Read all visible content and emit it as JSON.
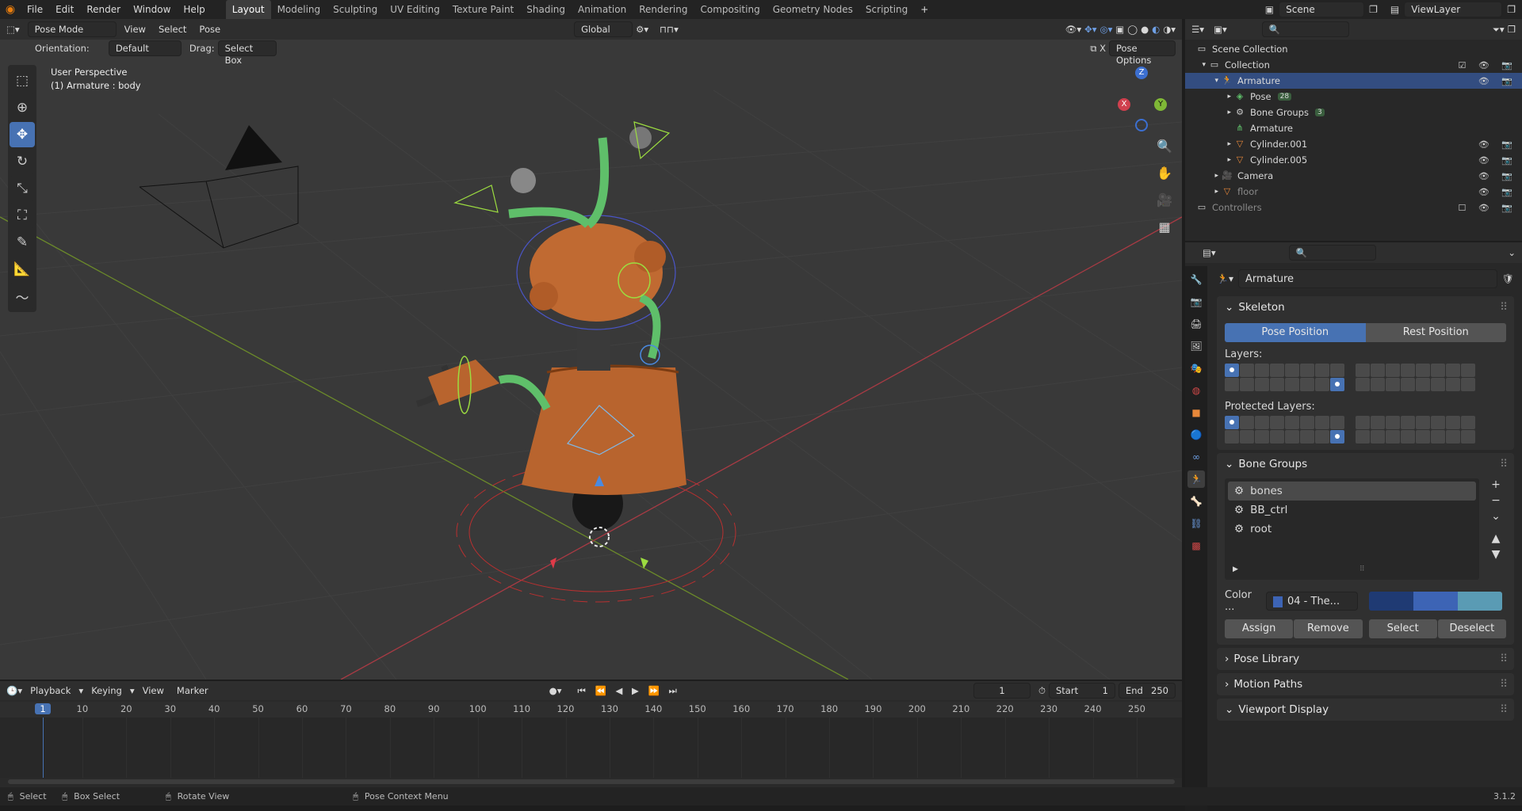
{
  "menu": {
    "file": "File",
    "edit": "Edit",
    "render": "Render",
    "window": "Window",
    "help": "Help"
  },
  "workspaces": [
    "Layout",
    "Modeling",
    "Sculpting",
    "UV Editing",
    "Texture Paint",
    "Shading",
    "Animation",
    "Rendering",
    "Compositing",
    "Geometry Nodes",
    "Scripting"
  ],
  "scene_name": "Scene",
  "view_layer": "ViewLayer",
  "viewport": {
    "mode": "Pose Mode",
    "menus": [
      "View",
      "Select",
      "Pose"
    ],
    "transform_orientation": "Global",
    "orientation_label": "Orientation:",
    "orientation_value": "Default",
    "drag_label": "Drag:",
    "drag_value": "Select Box",
    "pose_options": "Pose Options",
    "perspective": "User Perspective",
    "active": "(1) Armature : body",
    "axes": {
      "x": "X",
      "y": "Y",
      "z": "Z"
    }
  },
  "outliner": {
    "items": [
      {
        "label": "Scene Collection",
        "icon": "collection-icon"
      },
      {
        "label": "Collection",
        "icon": "collection-icon"
      },
      {
        "label": "Armature",
        "icon": "armature-icon"
      },
      {
        "label": "Pose",
        "icon": "pose-icon",
        "badge": "28"
      },
      {
        "label": "Bone Groups",
        "icon": "bone-groups-icon",
        "badge": "3"
      },
      {
        "label": "Armature",
        "icon": "armature-data-icon"
      },
      {
        "label": "Cylinder.001",
        "icon": "mesh-icon"
      },
      {
        "label": "Cylinder.005",
        "icon": "mesh-icon"
      },
      {
        "label": "Camera",
        "icon": "camera-icon"
      },
      {
        "label": "floor",
        "icon": "mesh-icon"
      },
      {
        "label": "Controllers",
        "icon": "collection-icon"
      }
    ]
  },
  "properties": {
    "object_name": "Armature",
    "skeleton": {
      "title": "Skeleton",
      "pose_position": "Pose Position",
      "rest_position": "Rest Position",
      "layers_label": "Layers:",
      "protected_label": "Protected Layers:"
    },
    "bone_groups": {
      "title": "Bone Groups",
      "items": [
        "bones",
        "BB_ctrl",
        "root"
      ],
      "color_label": "Color ...",
      "color_value": "04 - The...",
      "assign": "Assign",
      "remove": "Remove",
      "select": "Select",
      "deselect": "Deselect",
      "swatches": [
        "#1f3a73",
        "#3d64b5",
        "#5a9bb4"
      ]
    },
    "collapsed": [
      "Pose Library",
      "Motion Paths",
      "Viewport Display"
    ]
  },
  "timeline": {
    "menus": [
      "Playback",
      "Keying",
      "View",
      "Marker"
    ],
    "current_frame": "1",
    "start_label": "Start",
    "start": "1",
    "end_label": "End",
    "end": "250",
    "ticks": [
      "1",
      "10",
      "20",
      "30",
      "40",
      "50",
      "60",
      "70",
      "80",
      "90",
      "100",
      "110",
      "120",
      "130",
      "140",
      "150",
      "160",
      "170",
      "180",
      "190",
      "200",
      "210",
      "220",
      "230",
      "240",
      "250"
    ]
  },
  "status": {
    "select": "Select",
    "box_select": "Box Select",
    "rotate": "Rotate View",
    "context": "Pose Context Menu",
    "version": "3.1.2"
  }
}
